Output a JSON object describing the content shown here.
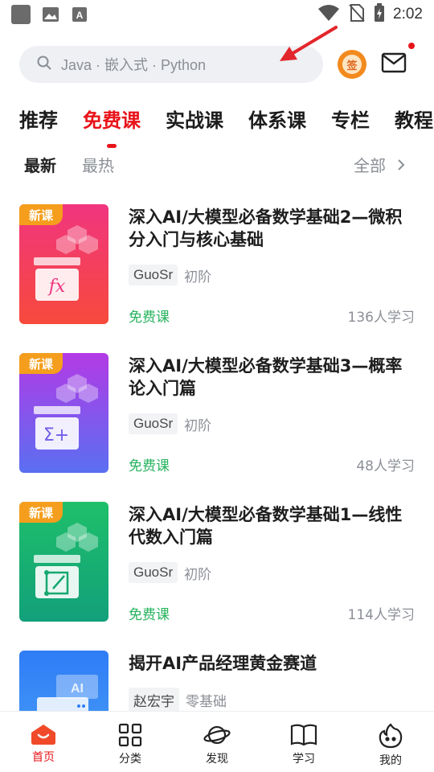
{
  "status_bar": {
    "time": "2:02"
  },
  "search": {
    "placeholder": "Java · 嵌入式 · Python"
  },
  "checkin": {
    "label": "签"
  },
  "tabs": [
    {
      "label": "推荐"
    },
    {
      "label": "免费课"
    },
    {
      "label": "实战课"
    },
    {
      "label": "体系课"
    },
    {
      "label": "专栏"
    },
    {
      "label": "教程"
    }
  ],
  "active_tab": "免费课",
  "subtabs": [
    {
      "label": "最新"
    },
    {
      "label": "最热"
    }
  ],
  "filter_all": "全部",
  "courses": [
    {
      "badge": "新课",
      "title": "深入AI/大模型必备数学基础2—微积分入门与核心基础",
      "author": "GuoSr",
      "level": "初阶",
      "price": "免费课",
      "learners": "136人学习",
      "icon": "fx-icon",
      "color_top": "#f0357f",
      "color_bottom": "#f74a3c"
    },
    {
      "badge": "新课",
      "title": "深入AI/大模型必备数学基础3—概率论入门篇",
      "author": "GuoSr",
      "level": "初阶",
      "price": "免费课",
      "learners": "48人学习",
      "icon": "sigma-plus-icon",
      "color_top": "#b33ae5",
      "color_bottom": "#5a6ff2"
    },
    {
      "badge": "新课",
      "title": "深入AI/大模型必备数学基础1—线性代数入门篇",
      "author": "GuoSr",
      "level": "初阶",
      "price": "免费课",
      "learners": "114人学习",
      "icon": "vector-edit-icon",
      "color_top": "#1fbf6a",
      "color_bottom": "#12a07a"
    },
    {
      "badge": "",
      "title": "揭开AI产品经理黄金赛道",
      "author": "赵宏宇",
      "level": "零基础",
      "price": "",
      "learners": "",
      "icon": "ai-window-icon",
      "color_top": "#2f7cf6",
      "color_bottom": "#4aa3f7"
    }
  ],
  "colors": {
    "accent": "#e8141a",
    "free": "#26b35d",
    "muted": "#8b8f96"
  },
  "bottom_nav": [
    {
      "label": "首页",
      "icon": "home-icon"
    },
    {
      "label": "分类",
      "icon": "grid-icon"
    },
    {
      "label": "发现",
      "icon": "planet-icon"
    },
    {
      "label": "学习",
      "icon": "book-icon"
    },
    {
      "label": "我的",
      "icon": "profile-flame-icon"
    }
  ]
}
